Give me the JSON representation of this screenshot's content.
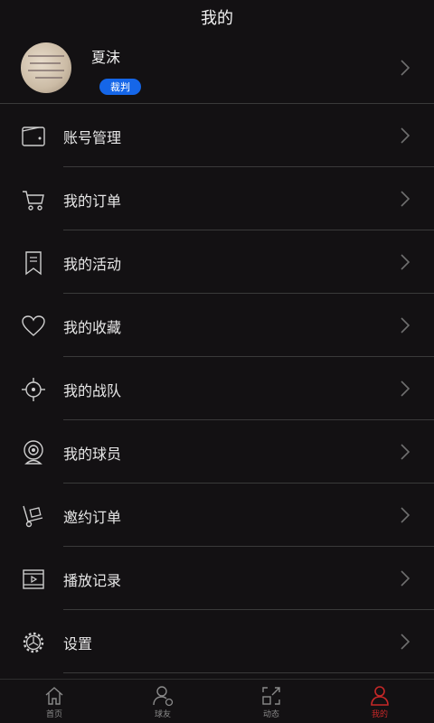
{
  "header": {
    "title": "我的"
  },
  "profile": {
    "name": "夏沫",
    "role": "裁判"
  },
  "menu": [
    {
      "label": "账号管理",
      "icon": "wallet-icon"
    },
    {
      "label": "我的订单",
      "icon": "cart-icon"
    },
    {
      "label": "我的活动",
      "icon": "bookmark-icon"
    },
    {
      "label": "我的收藏",
      "icon": "heart-icon"
    },
    {
      "label": "我的战队",
      "icon": "target-icon"
    },
    {
      "label": "我的球员",
      "icon": "webcam-icon"
    },
    {
      "label": "邀约订单",
      "icon": "hand-truck-icon"
    },
    {
      "label": "播放记录",
      "icon": "video-icon"
    },
    {
      "label": "设置",
      "icon": "gear-icon"
    }
  ],
  "tabs": [
    {
      "label": "首页",
      "icon": "home-icon",
      "active": false
    },
    {
      "label": "球友",
      "icon": "user-add-icon",
      "active": false
    },
    {
      "label": "动态",
      "icon": "dynamic-icon",
      "active": false
    },
    {
      "label": "我的",
      "icon": "person-icon",
      "active": true
    }
  ],
  "colors": {
    "background": "#131113",
    "accent": "#1566e8",
    "active_tab": "#c62828"
  }
}
